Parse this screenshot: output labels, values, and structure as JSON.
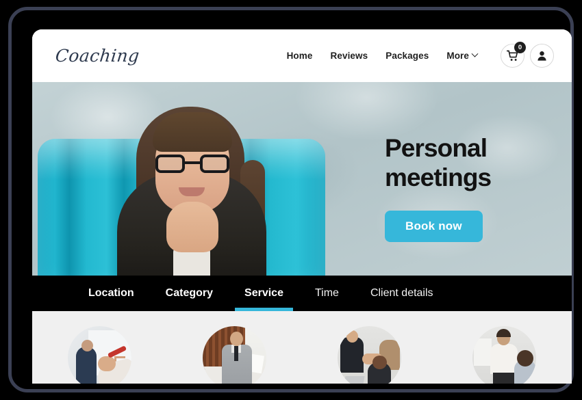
{
  "site": {
    "brand": "Coaching"
  },
  "header": {
    "nav": [
      {
        "label": "Home",
        "icon": ""
      },
      {
        "label": "Reviews",
        "icon": ""
      },
      {
        "label": "Packages",
        "icon": ""
      },
      {
        "label": "More",
        "icon": "chevron-down-icon"
      }
    ],
    "cart": {
      "icon": "shopping-cart-icon",
      "badge_count": "0"
    },
    "account": {
      "icon": "user-account-icon"
    }
  },
  "hero": {
    "title_line1": "Personal",
    "title_line2": "meetings",
    "cta_label": "Book now",
    "image_alt": "woman-with-glasses-in-teal-armchair"
  },
  "booking": {
    "steps": [
      {
        "label": "Location",
        "state": "done"
      },
      {
        "label": "Category",
        "state": "done"
      },
      {
        "label": "Service",
        "state": "active"
      },
      {
        "label": "Time",
        "state": "upcoming"
      },
      {
        "label": "Client details",
        "state": "upcoming"
      }
    ]
  },
  "services": [
    {
      "id": "service-1",
      "image_alt": "person-writing-on-whiteboard"
    },
    {
      "id": "service-2",
      "image_alt": "man-in-gray-suit-presenting"
    },
    {
      "id": "service-3",
      "image_alt": "team-handshake-at-meeting-table"
    },
    {
      "id": "service-4",
      "image_alt": "woman-coaching-seated-colleague"
    }
  ],
  "colors": {
    "accent": "#36b7da",
    "brand_text": "#2e3a4e",
    "tab_bar": "#000000",
    "services_bg": "#f0f0f0",
    "device_frame": "#3b4054",
    "chair_teal": "#25bad0"
  }
}
